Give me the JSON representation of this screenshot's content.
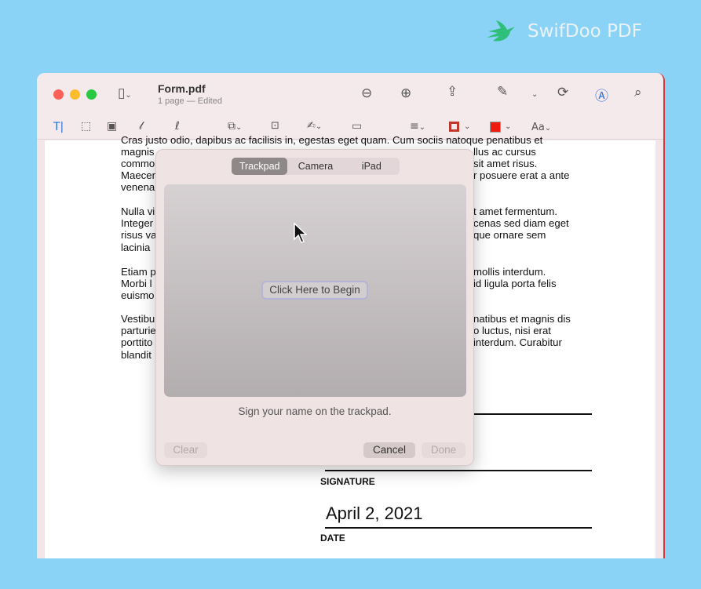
{
  "brand": {
    "name": "SwifDoo PDF",
    "color": "#2fbf7a"
  },
  "window": {
    "title": "Form.pdf",
    "subtitle": "1 page — Edited"
  },
  "toolbar": {
    "top": [
      "sidebar-icon",
      "zoom-out-icon",
      "zoom-in-icon",
      "share-icon",
      "markup-pen-icon",
      "rotate-icon",
      "markup-circle-icon",
      "search-icon"
    ],
    "markup": [
      "text-selection-icon",
      "rect-selection-icon",
      "redact-icon",
      "sketch-icon",
      "draw-icon",
      "shapes-icon",
      "text-box-icon",
      "sign-icon",
      "note-icon",
      "line-style-icon",
      "border-color-icon",
      "fill-color-icon",
      "font-icon"
    ],
    "font_label": "Aa",
    "border_color": "#c0392b",
    "fill_color": "#ee1c0e"
  },
  "document": {
    "lines": [
      {
        "l": "Cras justo odio, dapibus ac facilisis in, egestas eget quam. Cum sociis natoque penatibus et",
        "r": ""
      },
      {
        "l": "magnis",
        "r": "llus ac cursus"
      },
      {
        "l": "commo",
        "r": "sit amet risus."
      },
      {
        "l": "Maecer",
        "r": "r posuere erat a ante"
      },
      {
        "l": "venena",
        "r": ""
      },
      {
        "l": "Nulla vi",
        "r": "t amet fermentum."
      },
      {
        "l": "Integer",
        "r": "cenas sed diam eget"
      },
      {
        "l": "risus va",
        "r": "que ornare sem"
      },
      {
        "l": "lacinia",
        "r": ""
      },
      {
        "l": "Etiam p",
        "r": "mollis interdum."
      },
      {
        "l": "Morbi l",
        "r": "id ligula porta felis"
      },
      {
        "l": "euismo",
        "r": ""
      },
      {
        "l": "Vestibu",
        "r": "natibus et magnis dis"
      },
      {
        "l": "parturie",
        "r": "o luctus, nisi erat"
      },
      {
        "l": "porttito",
        "r": "interdum. Curabitur"
      },
      {
        "l": "blandit",
        "r": ""
      }
    ],
    "signature_label": "SIGNATURE",
    "date_value": "April 2, 2021",
    "date_label": "DATE"
  },
  "dialog": {
    "tabs": [
      "Trackpad",
      "Camera",
      "iPad"
    ],
    "active_tab": "Trackpad",
    "begin": "Click Here to Begin",
    "hint": "Sign your name on the trackpad.",
    "clear": "Clear",
    "cancel": "Cancel",
    "done": "Done"
  }
}
